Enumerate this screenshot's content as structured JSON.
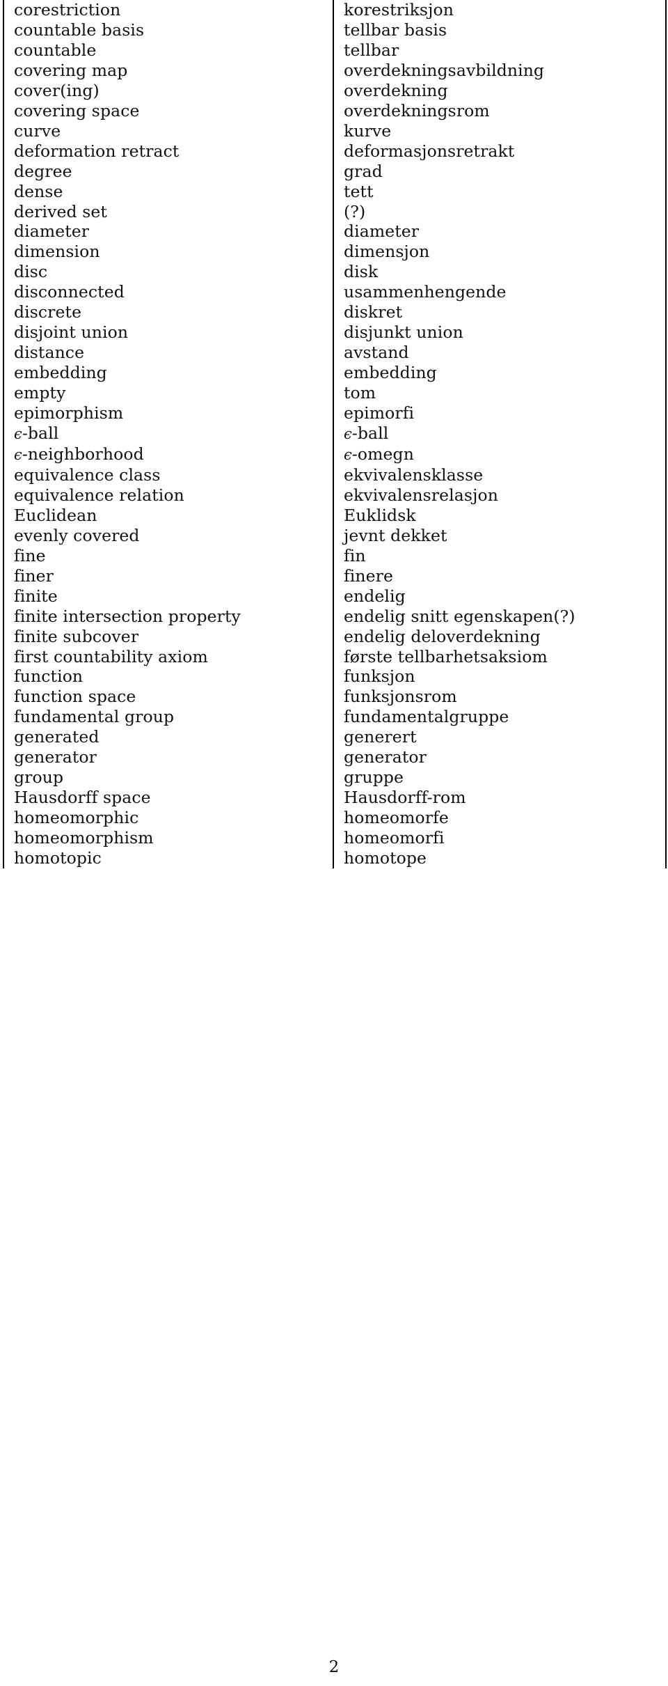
{
  "document": {
    "kind": "bilingual-glossary-table",
    "column_headers_visible": false,
    "page_number": "2",
    "rule_color": "#000000",
    "text_color": "#111111",
    "background_color": "#ffffff"
  },
  "glossary": {
    "rows": [
      {
        "en": "corestriction",
        "no": "korestriksjon"
      },
      {
        "en": "countable basis",
        "no": "tellbar basis"
      },
      {
        "en": "countable",
        "no": "tellbar"
      },
      {
        "en": "covering map",
        "no": "overdekningsavbildning"
      },
      {
        "en": "cover(ing)",
        "no": "overdekning"
      },
      {
        "en": "covering space",
        "no": "overdekningsrom"
      },
      {
        "en": "curve",
        "no": "kurve"
      },
      {
        "en": "deformation retract",
        "no": "deformasjonsretrakt"
      },
      {
        "en": "degree",
        "no": "grad"
      },
      {
        "en": "dense",
        "no": "tett"
      },
      {
        "en": "derived set",
        "no": "(?)"
      },
      {
        "en": "diameter",
        "no": "diameter"
      },
      {
        "en": "dimension",
        "no": "dimensjon"
      },
      {
        "en": "disc",
        "no": "disk"
      },
      {
        "en": "disconnected",
        "no": "usammenhengende"
      },
      {
        "en": "discrete",
        "no": "diskret"
      },
      {
        "en": "disjoint union",
        "no": "disjunkt union"
      },
      {
        "en": "distance",
        "no": "avstand"
      },
      {
        "en": "embedding",
        "no": "embedding"
      },
      {
        "en": "empty",
        "no": "tom"
      },
      {
        "en": "epimorphism",
        "no": "epimorfi"
      },
      {
        "en": "ϵ-ball",
        "no": "ϵ-ball"
      },
      {
        "en": "ϵ-neighborhood",
        "no": "ϵ-omegn"
      },
      {
        "en": "equivalence class",
        "no": "ekvivalensklasse"
      },
      {
        "en": "equivalence relation",
        "no": "ekvivalensrelasjon"
      },
      {
        "en": "Euclidean",
        "no": "Euklidsk"
      },
      {
        "en": "evenly covered",
        "no": "jevnt dekket"
      },
      {
        "en": "fine",
        "no": "fin"
      },
      {
        "en": "finer",
        "no": "finere"
      },
      {
        "en": "finite",
        "no": "endelig"
      },
      {
        "en": "finite intersection property",
        "no": "endelig snitt egenskapen(?)"
      },
      {
        "en": "finite subcover",
        "no": "endelig deloverdekning"
      },
      {
        "en": "first countability axiom",
        "no": "første tellbarhetsaksiom"
      },
      {
        "en": "function",
        "no": "funksjon"
      },
      {
        "en": "function space",
        "no": "funksjonsrom"
      },
      {
        "en": "fundamental group",
        "no": "fundamentalgruppe"
      },
      {
        "en": "generated",
        "no": "generert"
      },
      {
        "en": "generator",
        "no": "generator"
      },
      {
        "en": "group",
        "no": "gruppe"
      },
      {
        "en": "Hausdorff space",
        "no": "Hausdorff-rom"
      },
      {
        "en": "homeomorphic",
        "no": "homeomorfe"
      },
      {
        "en": "homeomorphism",
        "no": "homeomorfi"
      },
      {
        "en": "homotopic",
        "no": "homotope"
      }
    ]
  },
  "footer": {
    "page_number": "2"
  }
}
